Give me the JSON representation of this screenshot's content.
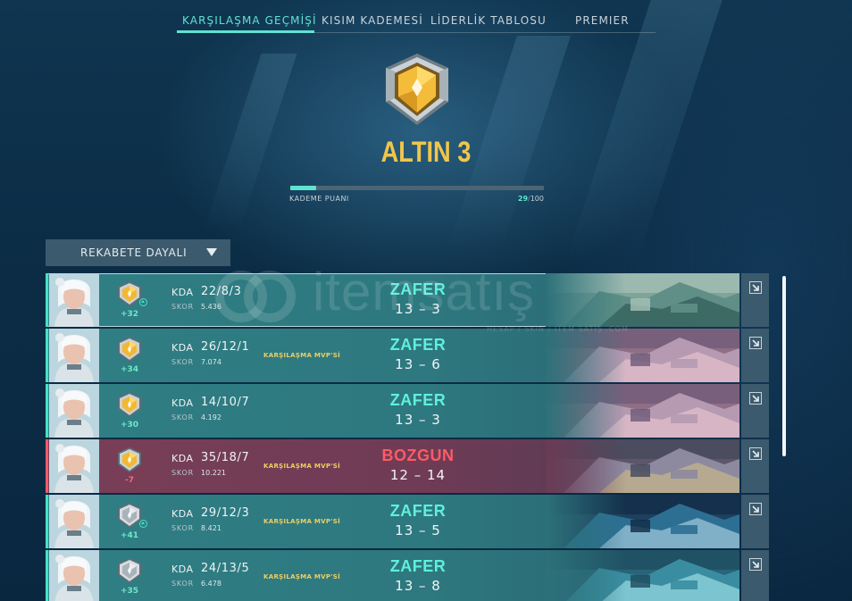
{
  "tabs": [
    {
      "label": "KARŞILAŞMA GEÇMİŞİ"
    },
    {
      "label": "KISIM KADEMESİ"
    },
    {
      "label": "LİDERLİK TABLOSU"
    },
    {
      "label": "PREMIER"
    }
  ],
  "rank": {
    "name": "ALTIN 3",
    "rr_label": "KADEME PUANI",
    "rr_current": "29",
    "rr_sep": "/",
    "rr_max": "100",
    "rr_fraction": 0.29
  },
  "filter": {
    "label": "REKABETE DAYALI"
  },
  "watermark": {
    "text": "itemsatış",
    "sub": "HESAP / SKIN / ITEM SATIŞ .COM"
  },
  "colors": {
    "accent": "#5fe3d0",
    "win": "#5ff0da",
    "loss": "#ff5a66",
    "gold": "#f0c64a",
    "mvp": "#efcf62"
  },
  "matches": [
    {
      "outcome": "win",
      "rank_icon": "gold-rank-icon",
      "rr_delta": "+32",
      "rank_up": true,
      "kda_label": "KDA",
      "kda": "22/8/3",
      "score_label": "SKOR",
      "score": "5.436",
      "mvp": "",
      "result": "ZAFER",
      "score_line": "13 – 3",
      "map": "green-island-map"
    },
    {
      "outcome": "win",
      "rank_icon": "gold-rank-icon",
      "rr_delta": "+34",
      "rank_up": false,
      "kda_label": "KDA",
      "kda": "26/12/1",
      "score_label": "SKOR",
      "score": "7.074",
      "mvp": "KARŞILAŞMA MVP'Sİ",
      "result": "ZAFER",
      "score_line": "13 – 6",
      "map": "coastal-town-map"
    },
    {
      "outcome": "win",
      "rank_icon": "gold-rank-icon",
      "rr_delta": "+30",
      "rank_up": false,
      "kda_label": "KDA",
      "kda": "14/10/7",
      "score_label": "SKOR",
      "score": "4.192",
      "mvp": "",
      "result": "ZAFER",
      "score_line": "13 – 3",
      "map": "coastal-town-map"
    },
    {
      "outcome": "loss",
      "rank_icon": "gold-rank-icon",
      "rr_delta": "-7",
      "rank_up": false,
      "kda_label": "KDA",
      "kda": "35/18/7",
      "score_label": "SKOR",
      "score": "10.221",
      "mvp": "KARŞILAŞMA MVP'Sİ",
      "result": "BOZGUN",
      "score_line": "12 – 14",
      "map": "japanese-village-map"
    },
    {
      "outcome": "win",
      "rank_icon": "silver-rank-icon",
      "rr_delta": "+41",
      "rank_up": true,
      "kda_label": "KDA",
      "kda": "29/12/3",
      "score_label": "SKOR",
      "score": "8.421",
      "mvp": "KARŞILAŞMA MVP'Sİ",
      "result": "ZAFER",
      "score_line": "13 – 5",
      "map": "ice-base-map"
    },
    {
      "outcome": "win",
      "rank_icon": "silver-rank-icon",
      "rr_delta": "+35",
      "rank_up": false,
      "kda_label": "KDA",
      "kda": "24/13/5",
      "score_label": "SKOR",
      "score": "6.478",
      "mvp": "KARŞILAŞMA MVP'Sİ",
      "result": "ZAFER",
      "score_line": "13 – 8",
      "map": "underwater-map"
    }
  ]
}
